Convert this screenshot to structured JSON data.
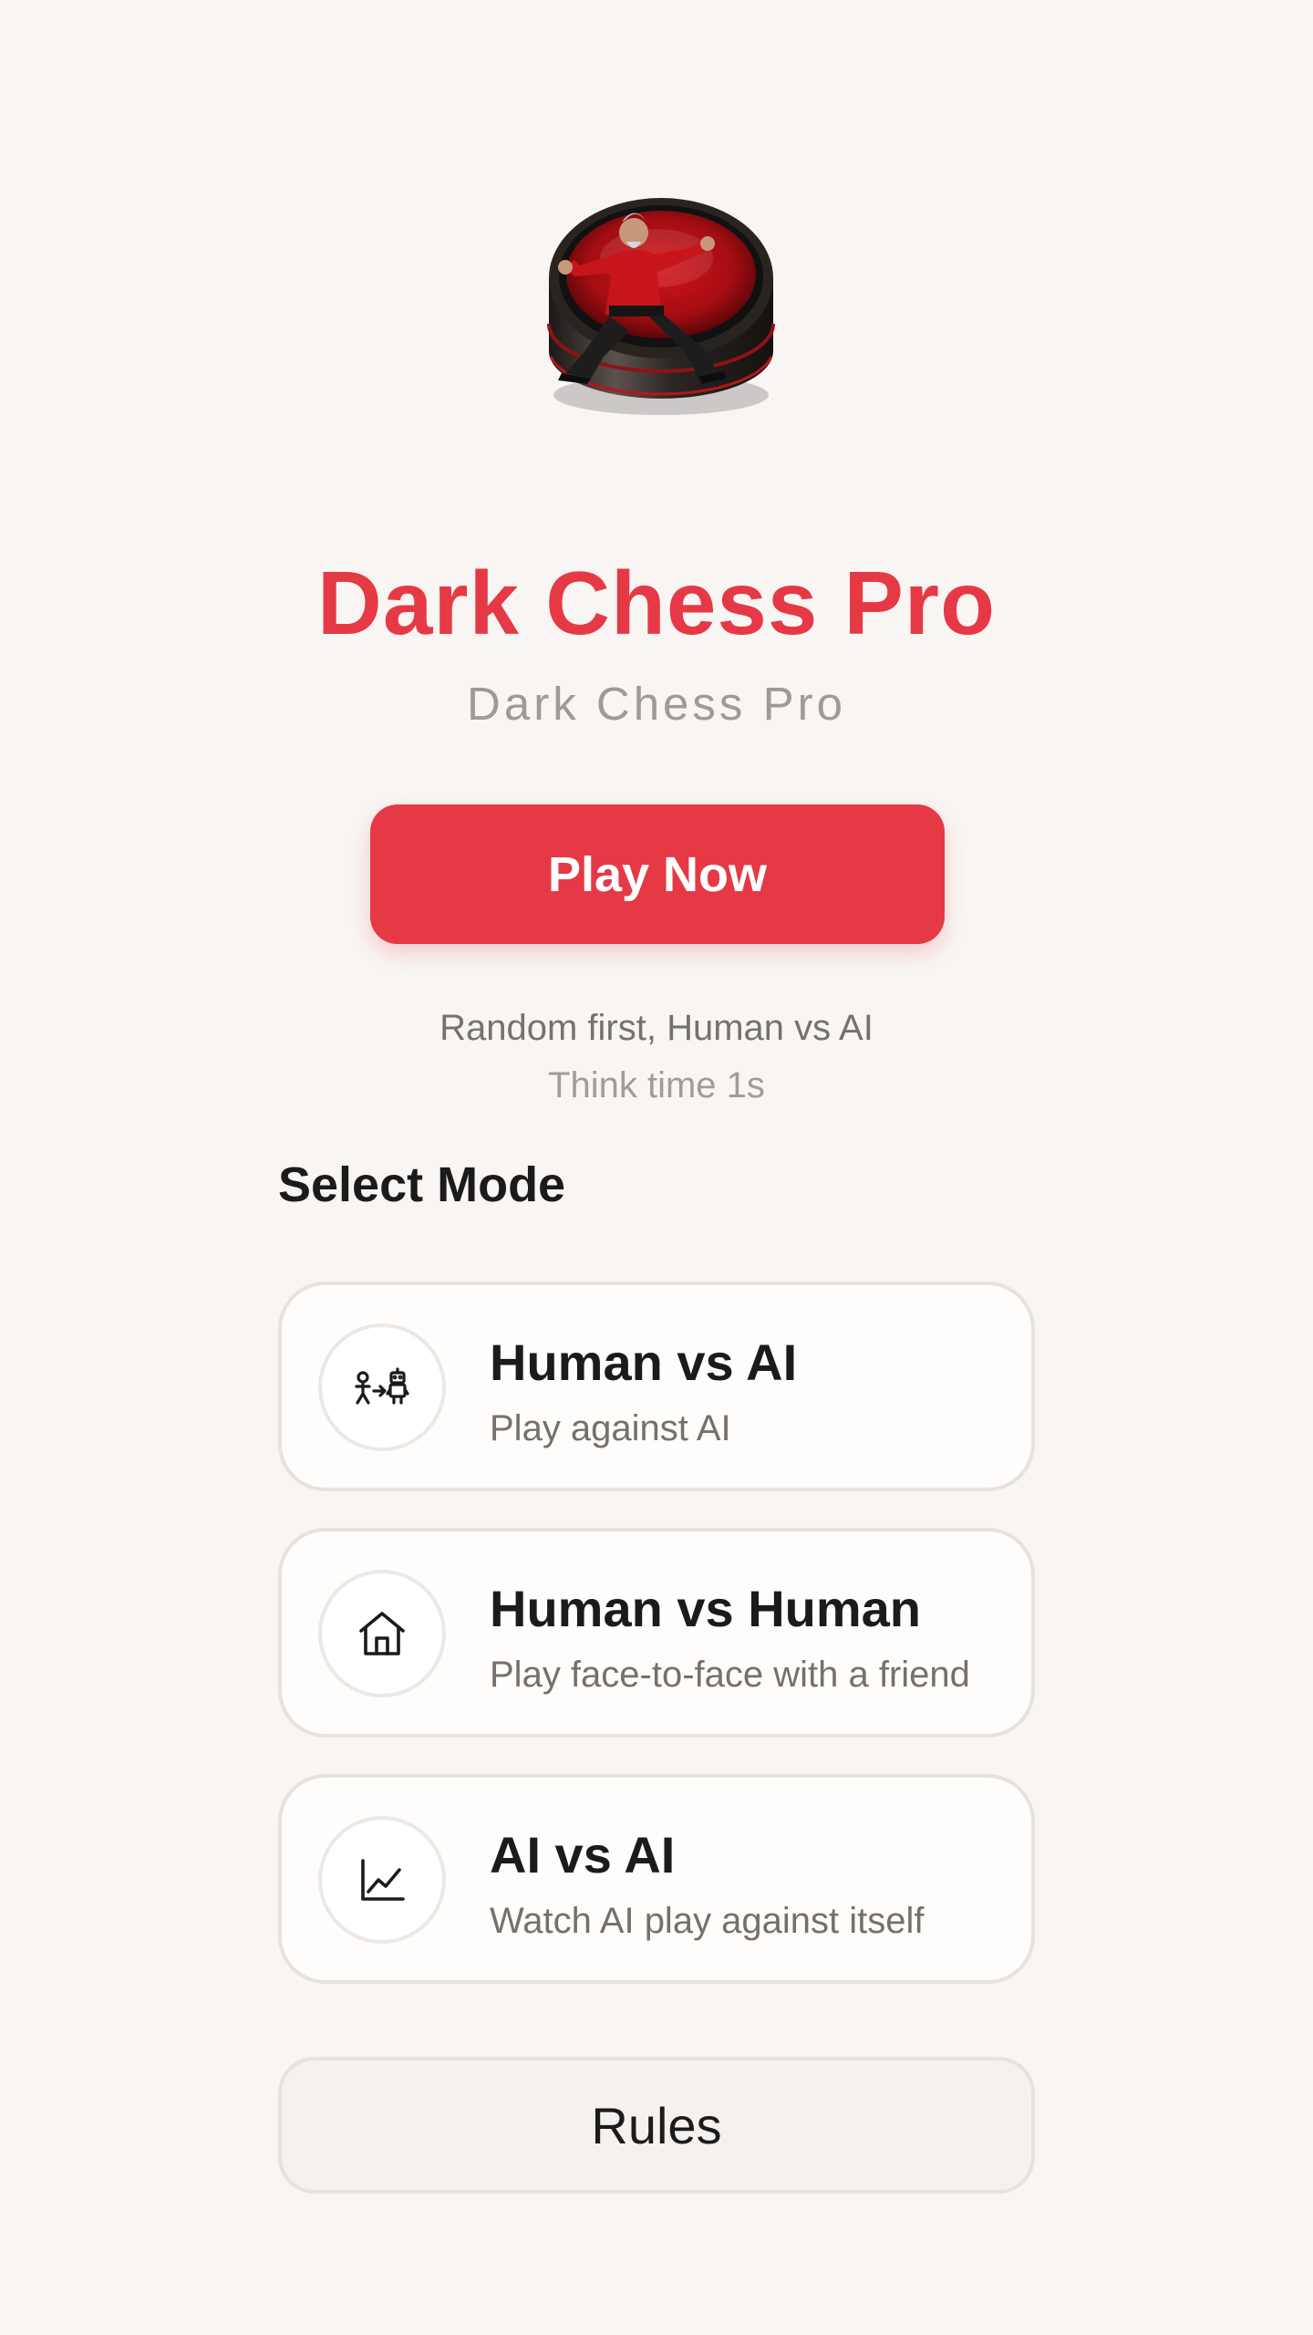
{
  "header": {
    "app_title": "Dark Chess Pro",
    "app_subtitle": "Dark Chess Pro"
  },
  "play": {
    "label": "Play Now",
    "info": "Random first, Human vs AI",
    "think_time": "Think time 1s"
  },
  "modes": {
    "section_title": "Select Mode",
    "items": [
      {
        "title": "Human vs AI",
        "description": "Play against AI",
        "icon": "human-vs-robot-icon"
      },
      {
        "title": "Human vs Human",
        "description": "Play face-to-face with a friend",
        "icon": "house-icon"
      },
      {
        "title": "AI vs AI",
        "description": "Watch AI play against itself",
        "icon": "chart-line-icon"
      }
    ]
  },
  "rules": {
    "label": "Rules"
  },
  "colors": {
    "accent": "#e63946",
    "background": "#f8f5f3",
    "card": "#fffdfb"
  }
}
